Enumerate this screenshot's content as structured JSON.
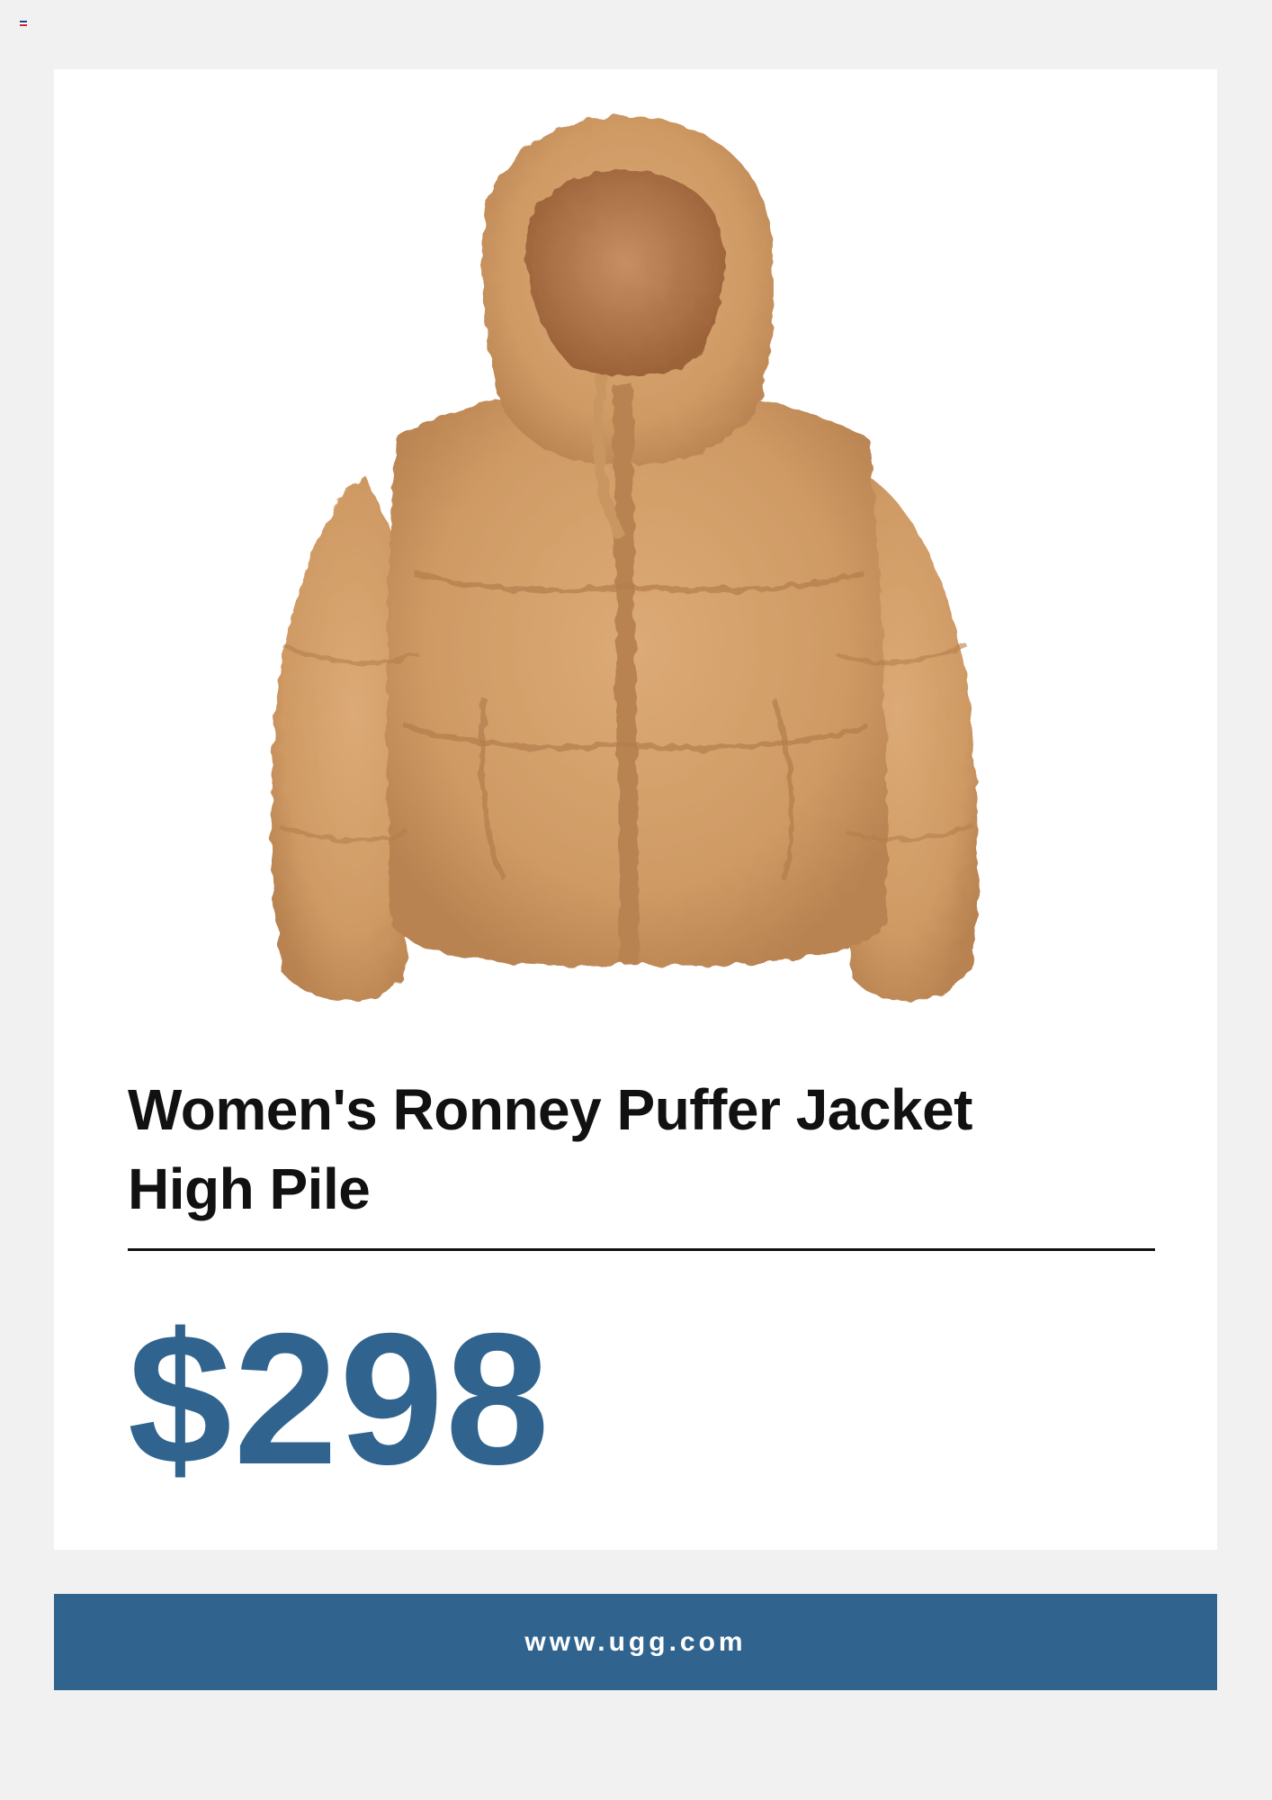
{
  "colors": {
    "background": "#f1f1f1",
    "card": "#ffffff",
    "accent": "#30648f",
    "title": "#111111",
    "jacket": "#d2a06c"
  },
  "product": {
    "image_icon": "puffer-jacket-image",
    "title": "Women's Ronney Puffer Jacket High Pile",
    "price": "$298"
  },
  "footer": {
    "url": "www.ugg.com"
  },
  "top_icon": "flag-icon"
}
